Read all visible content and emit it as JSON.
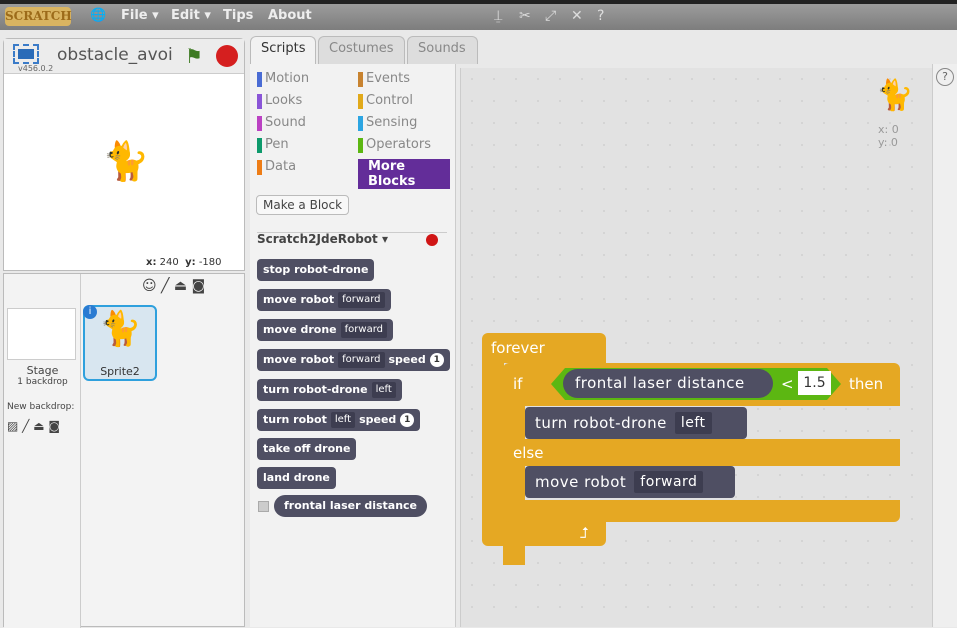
{
  "menubar": {
    "logo": "SCRATCH",
    "items": [
      "File ▾",
      "Edit ▾",
      "Tips",
      "About"
    ]
  },
  "stage": {
    "project_name": "obstacle_avoid",
    "version": "v456.0.2",
    "x_label": "x:",
    "x": "240",
    "y_label": "y:",
    "y": "-180"
  },
  "sprites": {
    "stage_label": "Stage",
    "backdrops": "1 backdrop",
    "new_backdrop": "New backdrop:",
    "sprite_name": "Sprite2"
  },
  "tabs": [
    "Scripts",
    "Costumes",
    "Sounds"
  ],
  "categories": [
    {
      "label": "Motion",
      "color": "#4a6cd4"
    },
    {
      "label": "Events",
      "color": "#c88330"
    },
    {
      "label": "Looks",
      "color": "#8a55d7"
    },
    {
      "label": "Control",
      "color": "#e1a91a"
    },
    {
      "label": "Sound",
      "color": "#bb42c3"
    },
    {
      "label": "Sensing",
      "color": "#2ca5e2"
    },
    {
      "label": "Pen",
      "color": "#0e9a6c"
    },
    {
      "label": "Operators",
      "color": "#5cb712"
    },
    {
      "label": "Data",
      "color": "#ee7d16"
    },
    {
      "label": "More Blocks",
      "color": "#632d99"
    }
  ],
  "palette": {
    "make_block": "Make a Block",
    "extension": "Scratch2JdeRobot ▾",
    "blocks": {
      "stop": "stop robot-drone",
      "move_robot": "move robot",
      "move_drone": "move drone",
      "forward": "forward",
      "speed": "speed",
      "one": "1",
      "turn_rd": "turn robot-drone",
      "turn_robot": "turn robot",
      "left": "left",
      "take_off": "take off drone",
      "land": "land drone",
      "laser": "frontal laser distance"
    }
  },
  "script": {
    "forever": "forever",
    "if": "if",
    "reporter": "frontal laser distance",
    "op": "<",
    "value": "1.5",
    "then": "then",
    "turn": "turn robot-drone",
    "turn_dir": "left",
    "else": "else",
    "move": "move robot",
    "move_dir": "forward"
  },
  "sprite_info": {
    "x": "x: 0",
    "y": "y: 0"
  }
}
